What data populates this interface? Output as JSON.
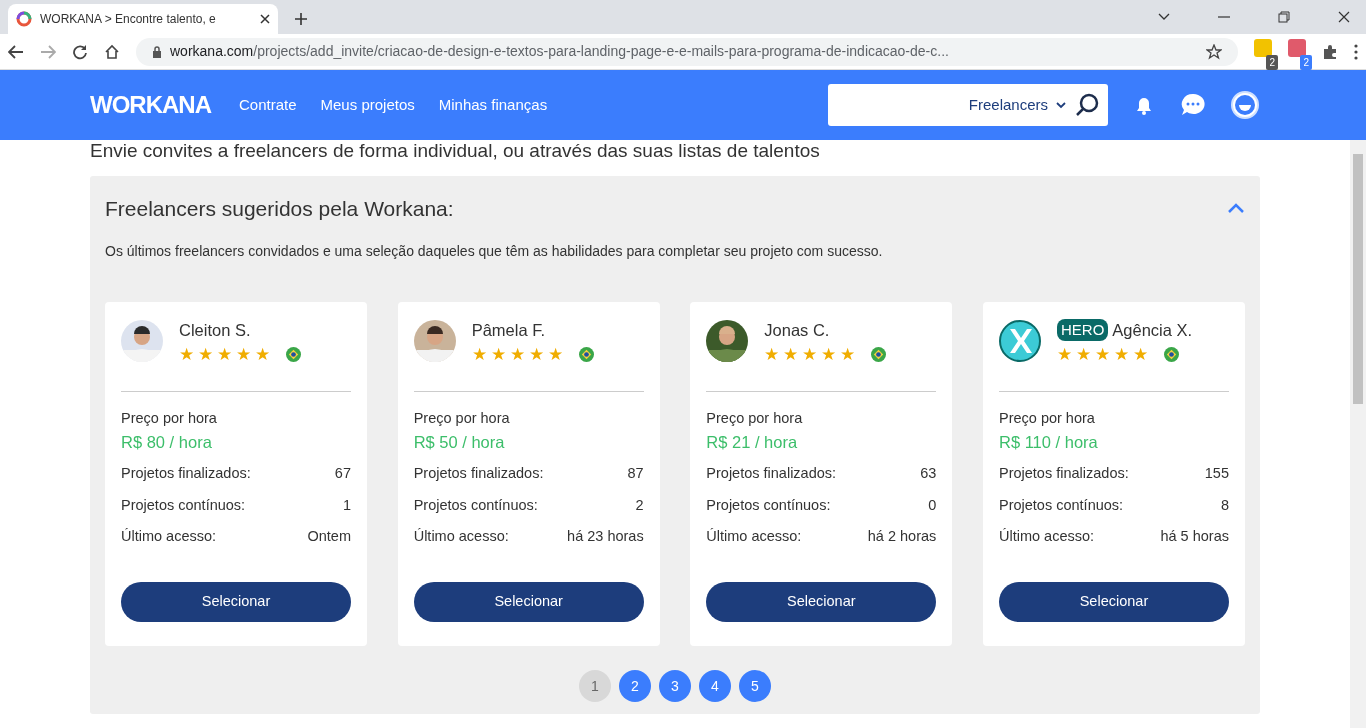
{
  "browser": {
    "tab_title": "WORKANA > Encontre talento, e",
    "url_host": "workana.com",
    "url_path": "/projects/add_invite/criacao-de-design-e-textos-para-landing-page-e-e-mails-para-programa-de-indicacao-de-c...",
    "extension_badges": [
      "2",
      "2"
    ]
  },
  "navbar": {
    "brand": "WORKANA",
    "links": [
      "Contrate",
      "Meus projetos",
      "Minhas finanças"
    ],
    "search": {
      "category": "Freelancers"
    }
  },
  "page_heading": "Envie convites a freelancers de forma individual, ou através das suas listas de talentos",
  "suggestions": {
    "title": "Freelancers sugeridos pela Workana:",
    "expanded": true,
    "description": "Os últimos freelancers convidados e uma seleção daqueles que têm as habilidades para completar seu projeto com sucesso.",
    "freelancers": [
      {
        "name": "Cleiton S.",
        "hero": false,
        "logo": false,
        "stars": 5,
        "price_label": "Preço por hora",
        "price": "R$ 80 / hora",
        "stats": [
          {
            "label": "Projetos finalizados:",
            "value": "67"
          },
          {
            "label": "Projetos contínuos:",
            "value": "1"
          },
          {
            "label": "Último acesso:",
            "value": "Ontem"
          }
        ],
        "button": "Selecionar"
      },
      {
        "name": "Pâmela F.",
        "hero": false,
        "logo": false,
        "stars": 5,
        "price_label": "Preço por hora",
        "price": "R$ 50 / hora",
        "stats": [
          {
            "label": "Projetos finalizados:",
            "value": "87"
          },
          {
            "label": "Projetos contínuos:",
            "value": "2"
          },
          {
            "label": "Último acesso:",
            "value": "há 23 horas"
          }
        ],
        "button": "Selecionar"
      },
      {
        "name": "Jonas C.",
        "hero": false,
        "logo": false,
        "stars": 5,
        "price_label": "Preço por hora",
        "price": "R$ 21 / hora",
        "stats": [
          {
            "label": "Projetos finalizados:",
            "value": "63"
          },
          {
            "label": "Projetos contínuos:",
            "value": "0"
          },
          {
            "label": "Último acesso:",
            "value": "há 2 horas"
          }
        ],
        "button": "Selecionar"
      },
      {
        "name": "Agência X.",
        "hero": true,
        "hero_label": "HERO",
        "logo": true,
        "stars": 5,
        "price_label": "Preço por hora",
        "price": "R$ 110 / hora",
        "stats": [
          {
            "label": "Projetos finalizados:",
            "value": "155"
          },
          {
            "label": "Projetos contínuos:",
            "value": "8"
          },
          {
            "label": "Último acesso:",
            "value": "há 5 horas"
          }
        ],
        "button": "Selecionar"
      }
    ],
    "pages": [
      {
        "label": "1",
        "selected": true
      },
      {
        "label": "2",
        "selected": false
      },
      {
        "label": "3",
        "selected": false
      },
      {
        "label": "4",
        "selected": false
      },
      {
        "label": "5",
        "selected": false
      }
    ]
  }
}
